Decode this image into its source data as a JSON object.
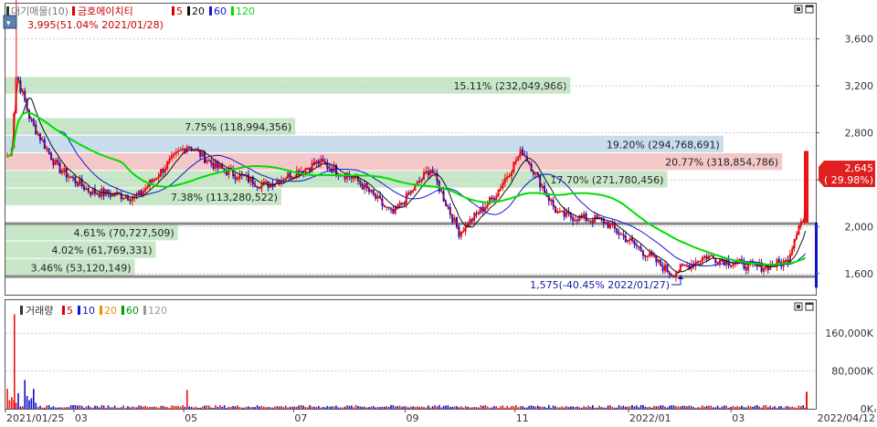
{
  "chart_data": [
    {
      "type": "candlestick",
      "title": "대기매물(10)",
      "stock_name": "금호에이치티",
      "ma_legend": [
        {
          "label": "5",
          "color": "#dd0000"
        },
        {
          "label": "20",
          "color": "#111111"
        },
        {
          "label": "60",
          "color": "#1515cc"
        },
        {
          "label": "120",
          "color": "#00dd00"
        }
      ],
      "high_annotation": "3,995(51.04% 2021/01/28)",
      "low_annotation": "1,575(-40.45% 2022/01/27)",
      "current_price": "2,645",
      "current_change": "( 29.98%)",
      "y_ticks": [
        1600,
        2000,
        2400,
        2800,
        3200,
        3600
      ],
      "y_tick_labels": [
        "1,600",
        "2,000",
        "2,400",
        "2,800",
        "3,200",
        "3,600"
      ],
      "ylim": [
        1420,
        3900
      ],
      "x_tick_labels": [
        "2021/01/25",
        "03",
        "05",
        "07",
        "09",
        "11",
        "2022/01",
        "03",
        "2022/04/12"
      ],
      "volume_profile": [
        {
          "label": "3.46% (53,120,149)",
          "low": 1575,
          "high": 1725,
          "pct": 3.46,
          "color": "#c8e6c8"
        },
        {
          "label": "4.02% (61,769,331)",
          "low": 1725,
          "high": 1875,
          "pct": 4.02,
          "color": "#c8e6c8"
        },
        {
          "label": "4.61% (70,727,509)",
          "low": 1875,
          "high": 2025,
          "pct": 4.61,
          "color": "#c8e6c8"
        },
        {
          "label": "7.38% (113,280,522)",
          "low": 2175,
          "high": 2325,
          "pct": 7.38,
          "color": "#c8e6c8"
        },
        {
          "label": "17.70% (271,780,456)",
          "low": 2325,
          "high": 2475,
          "pct": 17.7,
          "color": "#c8e6c8"
        },
        {
          "label": "20.77% (318,854,786)",
          "low": 2475,
          "high": 2625,
          "pct": 20.77,
          "color": "#f4c8c8"
        },
        {
          "label": "19.20% (294,768,691)",
          "low": 2625,
          "high": 2775,
          "pct": 19.2,
          "color": "#c8dcec"
        },
        {
          "label": "7.75% (118,994,356)",
          "low": 2775,
          "high": 2925,
          "pct": 7.75,
          "color": "#c8e6c8"
        },
        {
          "label": "15.11% (232,049,966)",
          "low": 3125,
          "high": 3275,
          "pct": 15.11,
          "color": "#c8e6c8"
        }
      ],
      "reference_lines": [
        1575,
        2025
      ],
      "price_series": [
        {
          "date": "2021/01/25",
          "close": 2600
        },
        {
          "date": "2021/01/28",
          "close": 3300
        },
        {
          "date": "2021/02/05",
          "close": 2900
        },
        {
          "date": "2021/02/20",
          "close": 2500
        },
        {
          "date": "2021/03/10",
          "close": 2300
        },
        {
          "date": "2021/04/05",
          "close": 2250
        },
        {
          "date": "2021/04/20",
          "close": 2500
        },
        {
          "date": "2021/05/03",
          "close": 2700
        },
        {
          "date": "2021/05/20",
          "close": 2500
        },
        {
          "date": "2021/06/15",
          "close": 2350
        },
        {
          "date": "2021/07/15",
          "close": 2550
        },
        {
          "date": "2021/08/05",
          "close": 2400
        },
        {
          "date": "2021/08/25",
          "close": 2100
        },
        {
          "date": "2021/09/15",
          "close": 2500
        },
        {
          "date": "2021/10/01",
          "close": 1950
        },
        {
          "date": "2021/10/20",
          "close": 2250
        },
        {
          "date": "2021/11/05",
          "close": 2650
        },
        {
          "date": "2021/11/25",
          "close": 2100
        },
        {
          "date": "2021/12/20",
          "close": 2050
        },
        {
          "date": "2022/01/27",
          "close": 1600
        },
        {
          "date": "2022/02/15",
          "close": 1750
        },
        {
          "date": "2022/03/15",
          "close": 1650
        },
        {
          "date": "2022/04/01",
          "close": 1700
        },
        {
          "date": "2022/04/08",
          "close": 2050
        },
        {
          "date": "2022/04/11",
          "close": 2035
        },
        {
          "date": "2022/04/12",
          "close": 2645
        }
      ]
    },
    {
      "type": "bar",
      "title": "거래량",
      "ma_legend": [
        {
          "label": "5",
          "color": "#dd0000"
        },
        {
          "label": "10",
          "color": "#1515cc"
        },
        {
          "label": "20",
          "color": "#e89000"
        },
        {
          "label": "60",
          "color": "#009900"
        },
        {
          "label": "120",
          "color": "#999999"
        }
      ],
      "y_ticks": [
        0,
        80000,
        160000
      ],
      "y_tick_labels": [
        "0K",
        "80,000K",
        "160,000K"
      ],
      "ylim": [
        0,
        230000
      ]
    }
  ]
}
